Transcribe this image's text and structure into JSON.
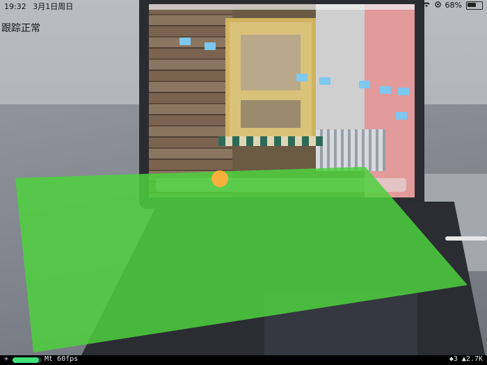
{
  "status_bar": {
    "time": "19:32",
    "date": "3月1日周日",
    "wifi_icon": "wifi-icon",
    "location_icon": "location-icon",
    "battery_percent": "68%",
    "battery_level": 0.68
  },
  "tracking_status": "跟踪正常",
  "ar_plane": {
    "color": "#4ed13e",
    "opacity": 0.85
  },
  "ar_anchor_color": "#f6b03b",
  "debug_bar": {
    "plus": "+",
    "meter_level": 0.9,
    "meter_color": "#40e07a",
    "fps_text": "Mt 60fps",
    "right_text": "◆3 ▲2.7K"
  }
}
